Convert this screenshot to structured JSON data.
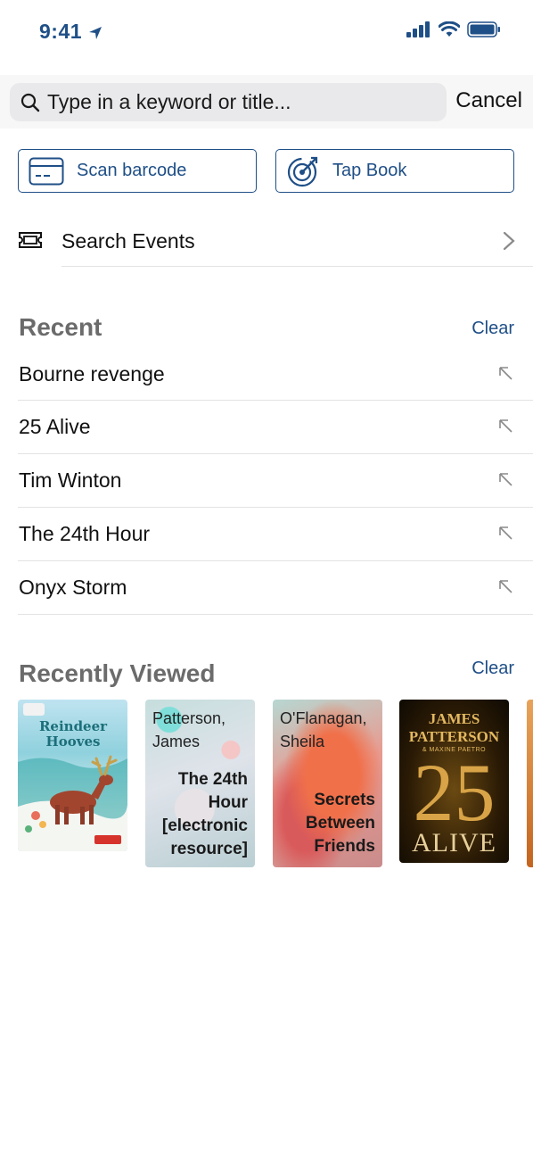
{
  "status_bar": {
    "time": "9:41"
  },
  "search": {
    "placeholder": "Type in a keyword or title...",
    "value": "",
    "cancel_label": "Cancel"
  },
  "actions": {
    "scan_label": "Scan barcode",
    "tap_label": "Tap Book"
  },
  "events": {
    "label": "Search Events"
  },
  "recent": {
    "title": "Recent",
    "clear_label": "Clear",
    "items": [
      "Bourne revenge",
      "25 Alive",
      "Tim Winton",
      "The 24th Hour",
      "Onyx Storm"
    ]
  },
  "recently_viewed": {
    "title": "Recently Viewed",
    "clear_label": "Clear",
    "books": [
      {
        "cover_title": "Reindeer Hooves",
        "style": "illustrated"
      },
      {
        "author": "Patterson, James",
        "title": "The 24th Hour [electronic resource]"
      },
      {
        "author": "O'Flanagan, Sheila",
        "title": "Secrets Between Friends"
      },
      {
        "cover_author": "JAMES PATTERSON",
        "cover_coauthor": "& MAXINE PAETRO",
        "cover_number": "25",
        "cover_title": "ALIVE"
      }
    ]
  },
  "colors": {
    "accent": "#1f4f87",
    "section_title": "#6b6b6b",
    "divider": "#e3e3e3"
  }
}
